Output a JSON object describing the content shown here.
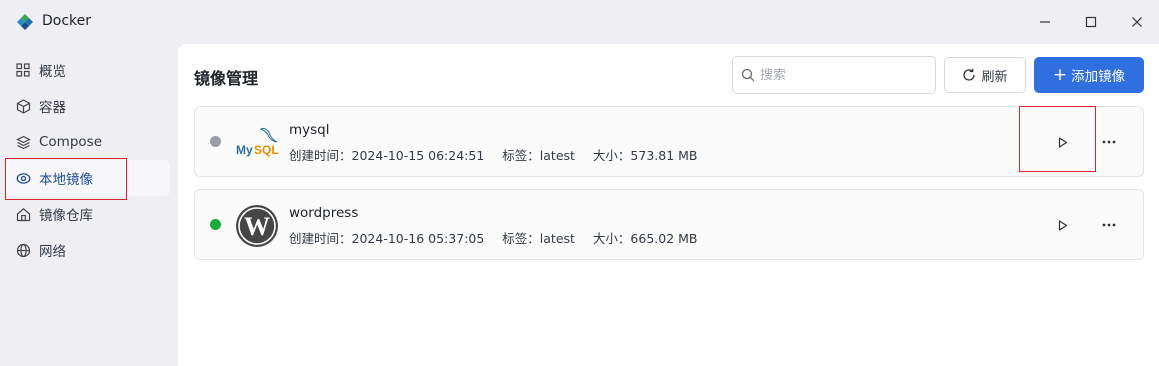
{
  "window": {
    "title": "Docker",
    "logo_icon": "docker-whale-icon",
    "minimize_icon": "minimize-icon",
    "maximize_icon": "maximize-icon",
    "close_icon": "close-icon"
  },
  "sidebar": {
    "items": [
      {
        "label": "概览",
        "icon": "grid-icon"
      },
      {
        "label": "容器",
        "icon": "cube-icon"
      },
      {
        "label": "Compose",
        "icon": "layers-icon"
      },
      {
        "label": "本地镜像",
        "icon": "disc-icon",
        "active": true
      },
      {
        "label": "镜像仓库",
        "icon": "home-icon"
      },
      {
        "label": "网络",
        "icon": "globe-icon"
      }
    ]
  },
  "main": {
    "title": "镜像管理",
    "search": {
      "placeholder": "搜索",
      "value": ""
    },
    "refresh_label": "刷新",
    "add_label": "添加镜像"
  },
  "images": [
    {
      "name": "mysql",
      "status": "stopped",
      "status_color": "#9a9ca6",
      "logo": "mysql-logo",
      "created_label": "创建时间：",
      "created": "2024-10-15 06:24:51",
      "tag_label": "标签：",
      "tag": "latest",
      "size_label": "大小：",
      "size": "573.81 MB"
    },
    {
      "name": "wordpress",
      "status": "running",
      "status_color": "#1aaa3c",
      "logo": "wordpress-logo",
      "created_label": "创建时间：",
      "created": "2024-10-16 05:37:05",
      "tag_label": "标签：",
      "tag": "latest",
      "size_label": "大小：",
      "size": "665.02 MB"
    }
  ],
  "colors": {
    "accent": "#2f6fe0",
    "highlight": "#d9262c",
    "sidebar_bg": "#eeeef3",
    "active_text": "#1f4e9a"
  }
}
